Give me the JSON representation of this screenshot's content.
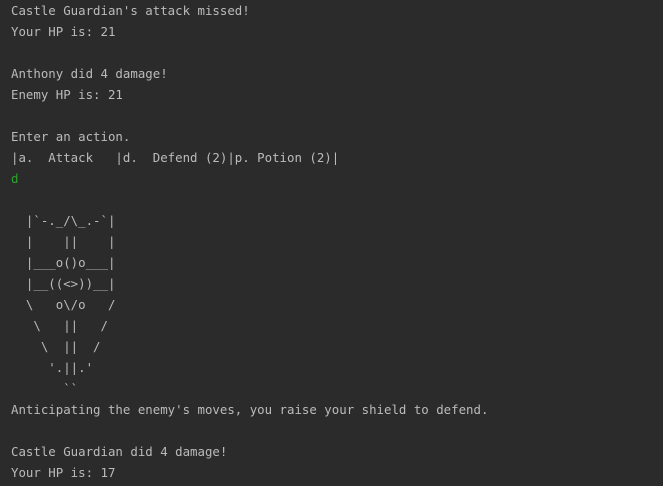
{
  "console": {
    "lines": [
      "Castle Guardian's attack missed!",
      "Your HP is: 21",
      "",
      "Anthony did 4 damage!",
      "Enemy HP is: 21",
      "",
      "Enter an action.",
      "|a.  Attack   |d.  Defend (2)|p. Potion (2)|"
    ],
    "user_input": "d",
    "art": [
      "",
      "  |`-._/\\_.-`|",
      "  |    ||    |",
      "  |___o()o___|",
      "  |__((<>))__|",
      "  \\   o\\/o   /",
      "   \\   ||   /",
      "    \\  ||  /",
      "     '.||.'",
      "       ``"
    ],
    "after": [
      "Anticipating the enemy's moves, you raise your shield to defend.",
      "",
      "Castle Guardian did 4 damage!",
      "Your HP is: 17"
    ]
  },
  "colors": {
    "background": "#2b2b2b",
    "text": "#bbbbbb",
    "input": "#2aa52a"
  }
}
